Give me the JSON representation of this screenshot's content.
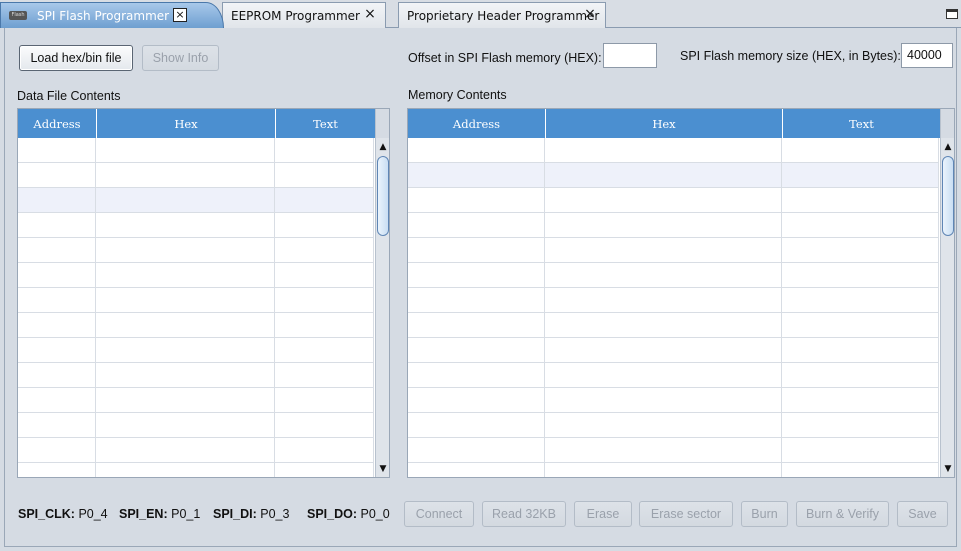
{
  "tabs": [
    {
      "label": "SPI Flash Programmer",
      "close": "×",
      "icon": "flash-chip-icon",
      "icon_text": "Flash"
    },
    {
      "label": "EEPROM Programmer",
      "close": "×"
    },
    {
      "label": "Proprietary Header Programmer",
      "close": "×"
    }
  ],
  "toolbar": {
    "load_label": "Load hex/bin file",
    "show_info_label": "Show Info",
    "offset_label": "Offset in SPI Flash memory (HEX):",
    "offset_value": "",
    "size_label": "SPI Flash memory size (HEX, in Bytes):",
    "size_value": "40000"
  },
  "data_file": {
    "title": "Data File Contents",
    "columns": [
      "Address",
      "Hex",
      "Text"
    ]
  },
  "memory": {
    "title": "Memory Contents",
    "columns": [
      "Address",
      "Hex",
      "Text"
    ]
  },
  "pins": [
    {
      "name": "SPI_CLK:",
      "value": "P0_4"
    },
    {
      "name": "SPI_EN:",
      "value": "P0_1"
    },
    {
      "name": "SPI_DI:",
      "value": "P0_3"
    },
    {
      "name": "SPI_DO:",
      "value": "P0_0"
    }
  ],
  "actions": {
    "connect": "Connect",
    "read": "Read 32KB",
    "erase": "Erase",
    "erase_sector": "Erase sector",
    "burn": "Burn",
    "burn_verify": "Burn & Verify",
    "save": "Save"
  },
  "scroll_arrows": {
    "up": "▲",
    "down": "▼"
  }
}
